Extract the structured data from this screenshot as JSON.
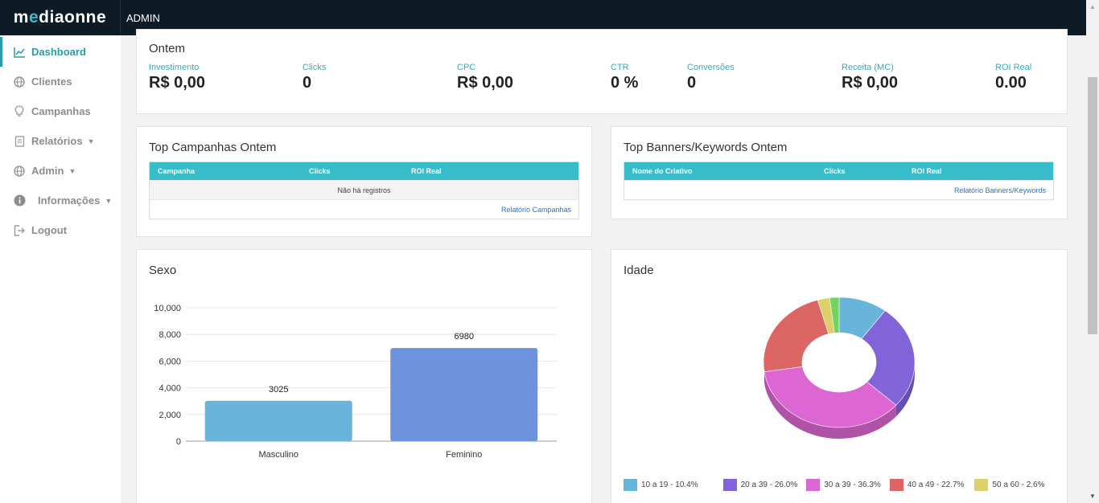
{
  "topbar": {
    "brand_prefix": "m",
    "brand_accent": "e",
    "brand_rest": "diaonne",
    "admin_label": "ADMIN"
  },
  "sidebar": {
    "items": [
      {
        "label": "Dashboard",
        "icon": "chart-line-icon",
        "active": true
      },
      {
        "label": "Clientes",
        "icon": "globe-icon"
      },
      {
        "label": "Campanhas",
        "icon": "lightbulb-icon"
      },
      {
        "label": "Relatórios",
        "icon": "book-icon",
        "dropdown": true
      },
      {
        "label": "Admin",
        "icon": "globe-icon",
        "dropdown": true
      },
      {
        "label": "Informações",
        "icon": "info-icon",
        "dropdown": true
      },
      {
        "label": "Logout",
        "icon": "logout-icon"
      }
    ]
  },
  "kpis": {
    "title": "Ontem",
    "items": [
      {
        "label": "Investimento",
        "value": "R$ 0,00"
      },
      {
        "label": "Clicks",
        "value": "0"
      },
      {
        "label": "CPC",
        "value": "R$ 0,00"
      },
      {
        "label": "CTR",
        "value": "0 %"
      },
      {
        "label": "Conversões",
        "value": "0"
      },
      {
        "label": "Receita (MC)",
        "value": "R$ 0,00"
      },
      {
        "label": "ROI Real",
        "value": "0.00"
      }
    ]
  },
  "top_campanhas": {
    "title": "Top Campanhas Ontem",
    "columns": [
      "Campanha",
      "Clicks",
      "ROI Real"
    ],
    "empty_text": "Não há registros",
    "link": "Relatório Campanhas"
  },
  "top_banners": {
    "title": "Top Banners/Keywords Ontem",
    "columns": [
      "Nome do Criativo",
      "Clicks",
      "ROI Real"
    ],
    "link": "Relatório Banners/Keywords"
  },
  "sexo": {
    "title": "Sexo"
  },
  "idade": {
    "title": "Idade"
  },
  "colors": {
    "accent": "#37bcc9",
    "topbar": "#0c1b26",
    "link": "#2277cc"
  },
  "chart_data": [
    {
      "type": "bar",
      "title": "Sexo",
      "categories": [
        "Masculino",
        "Feminino"
      ],
      "values": [
        3025,
        6980
      ],
      "data_labels": [
        "3025",
        "6980"
      ],
      "colors": [
        "#68b5dc",
        "#6c93dc"
      ],
      "ylim": [
        0,
        10000
      ],
      "yticks": [
        "0",
        "2,000",
        "4,000",
        "6,000",
        "8,000",
        "10,000"
      ],
      "grid": true
    },
    {
      "type": "pie",
      "title": "Idade",
      "style": "donut-3d",
      "labels": [
        "10 a 19",
        "20 a 39",
        "30 a 39",
        "40 a 49",
        "50 a 60",
        ""
      ],
      "legend_labels": [
        "10 a 19 - 10.4%",
        "20 a 39 - 26.0%",
        "30 a 39 - 36.3%",
        "40 a 49 - 22.7%",
        "50 a 60 - 2.6%"
      ],
      "values": [
        10.4,
        26.0,
        36.3,
        22.7,
        2.6,
        2.0
      ],
      "colors": [
        "#68b5dc",
        "#8064d8",
        "#dc66d2",
        "#dc6664",
        "#dcd06a",
        "#70d462"
      ],
      "legend_position": "bottom"
    }
  ]
}
